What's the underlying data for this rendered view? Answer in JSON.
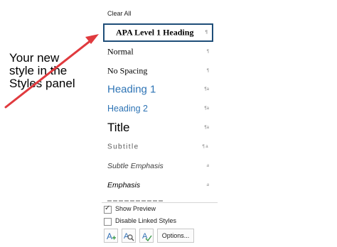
{
  "annotation": {
    "lines": [
      "Your new",
      "style in the",
      "Styles panel"
    ],
    "arrow_color": "#e03a3e"
  },
  "styles_panel": {
    "clear_all_label": "Clear All",
    "styles": [
      {
        "label": "APA Level 1 Heading",
        "mark": "¶",
        "selected": true
      },
      {
        "label": "Normal",
        "mark": "¶"
      },
      {
        "label": "No Spacing",
        "mark": "¶"
      },
      {
        "label": "Heading 1",
        "mark": "¶a"
      },
      {
        "label": "Heading 2",
        "mark": "¶a"
      },
      {
        "label": "Title",
        "mark": "¶a"
      },
      {
        "label": "Subtitle",
        "mark": "¶a"
      },
      {
        "label": "Subtle Emphasis",
        "mark": "a"
      },
      {
        "label": "Emphasis",
        "mark": "a"
      }
    ],
    "show_preview": {
      "label": "Show Preview",
      "checked": true
    },
    "disable_linked": {
      "label": "Disable Linked Styles",
      "checked": false
    },
    "buttons": {
      "new_style_icon": "new-style-icon",
      "style_inspector_icon": "style-inspector-icon",
      "manage_styles_icon": "manage-styles-icon",
      "options_label": "Options..."
    }
  },
  "colors": {
    "heading_blue": "#2e74b5",
    "selected_border": "#1f4e79",
    "icon_blue": "#2f6fb5",
    "icon_green": "#3a9a4a"
  }
}
